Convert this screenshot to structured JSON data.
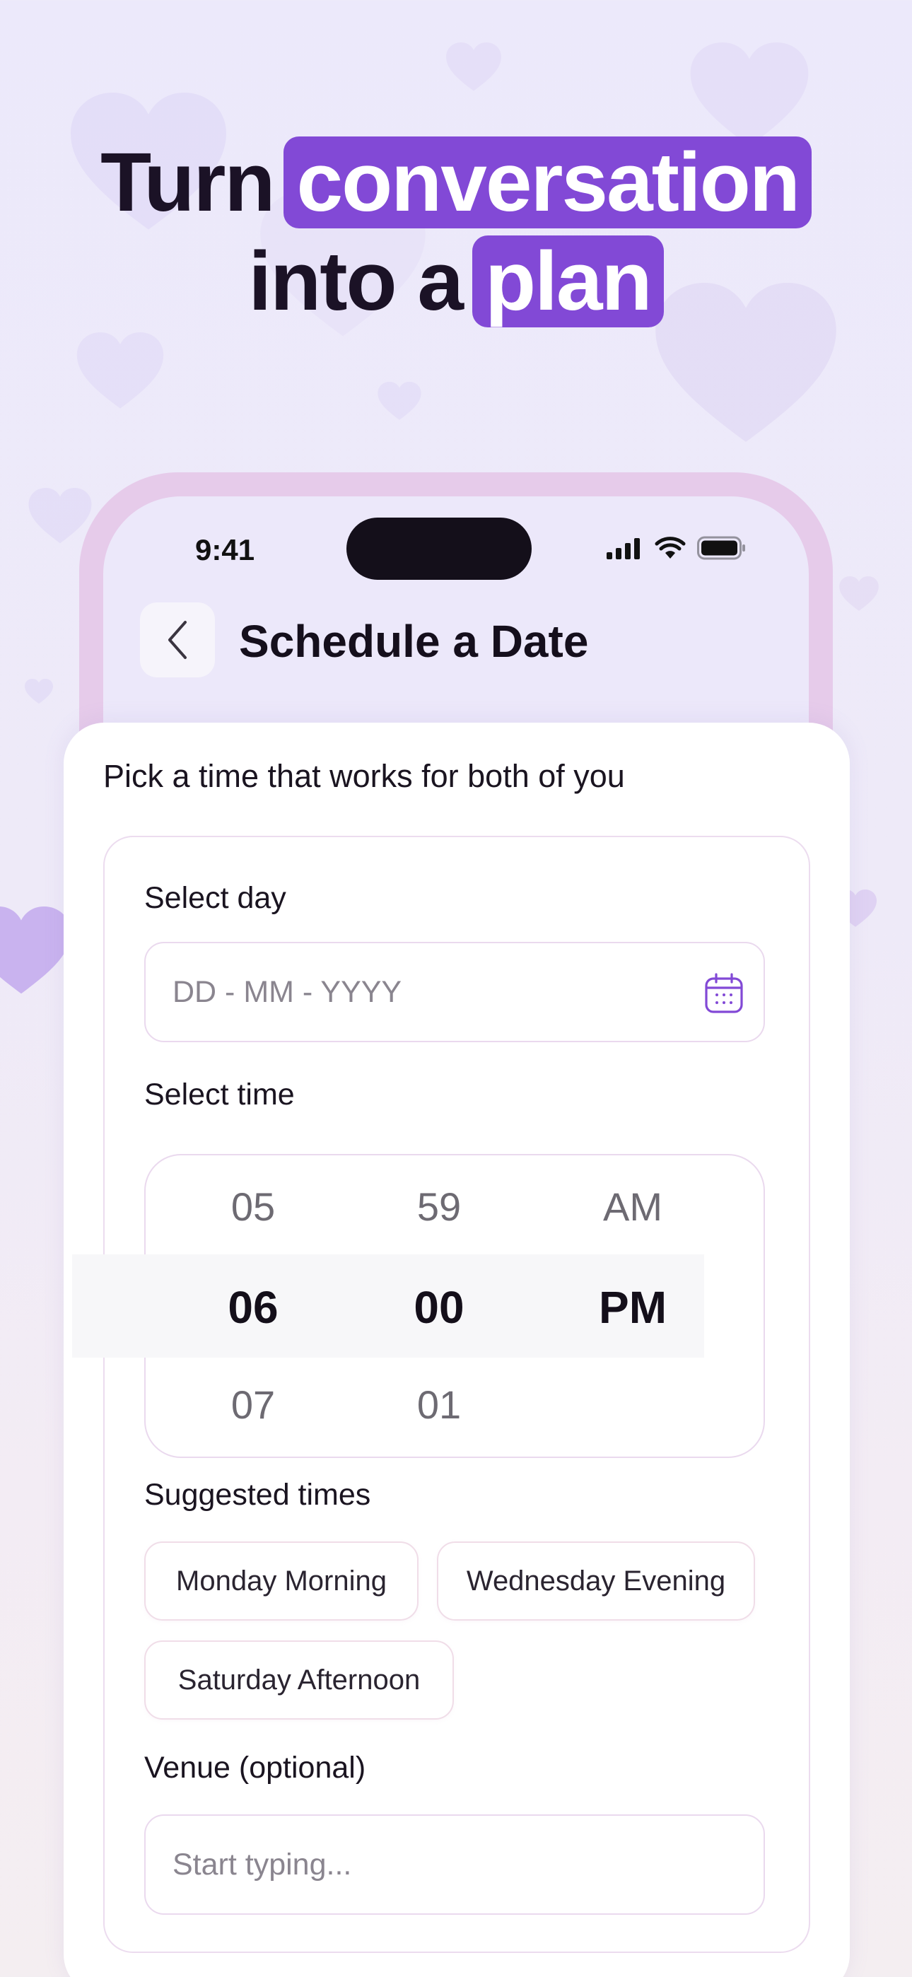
{
  "headline": {
    "line1_text": "Turn",
    "line1_highlight": "conversation",
    "line2_text": "into a",
    "line2_highlight": "plan",
    "highlight_color": "#8249d6"
  },
  "status_bar": {
    "time": "9:41"
  },
  "nav": {
    "title": "Schedule a Date"
  },
  "form": {
    "subtitle": "Pick a time that works for both of you",
    "day_label": "Select day",
    "day_placeholder": "DD - MM - YYYY",
    "time_label": "Select time",
    "time_picker": {
      "hours": [
        "05",
        "06",
        "07"
      ],
      "minutes": [
        "59",
        "00",
        "01"
      ],
      "periods": [
        "AM",
        "PM"
      ],
      "selected": {
        "hour": "06",
        "minute": "00",
        "period": "PM"
      }
    },
    "suggested_label": "Suggested times",
    "suggested": [
      "Monday Morning",
      "Wednesday Evening",
      "Saturday Afternoon"
    ],
    "venue_label": "Venue (optional)",
    "venue_placeholder": "Start typing..."
  }
}
